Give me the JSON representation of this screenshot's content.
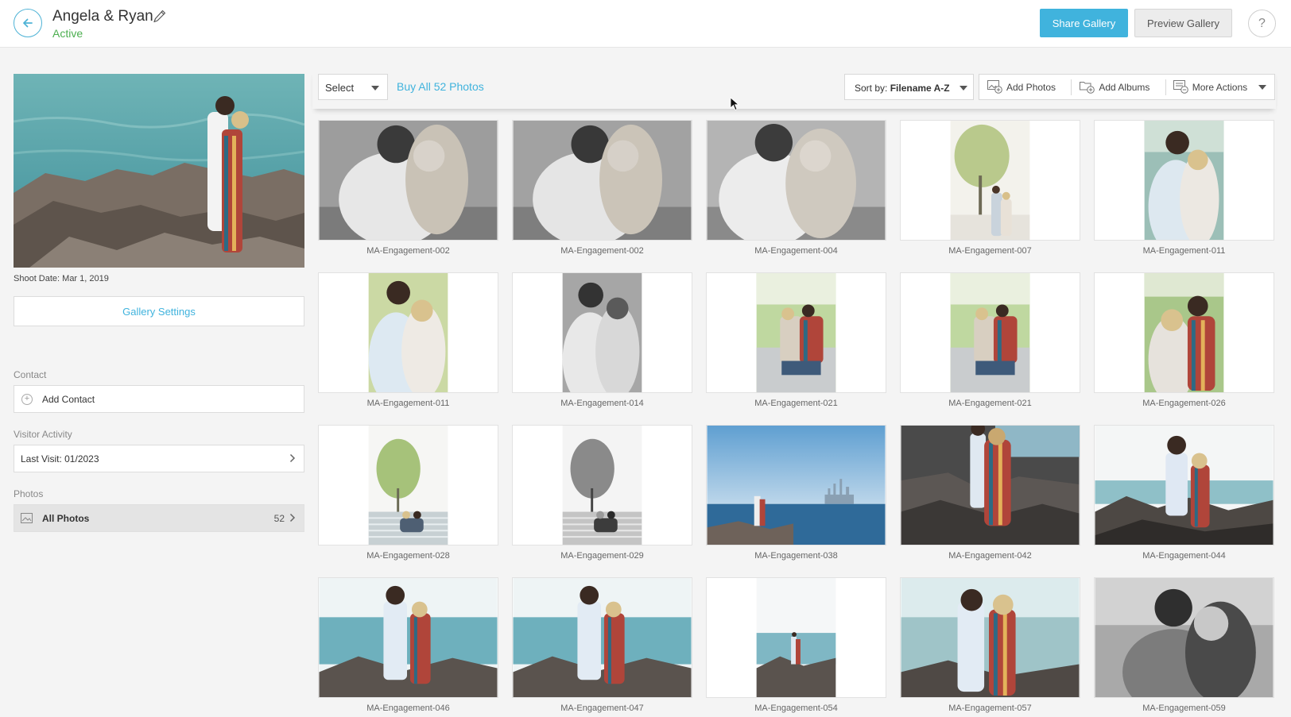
{
  "header": {
    "title": "Angela & Ryan",
    "status": "Active",
    "share_label": "Share Gallery",
    "preview_label": "Preview Gallery",
    "help_label": "?"
  },
  "sidebar": {
    "shoot_date": "Shoot Date: Mar 1, 2019",
    "settings_label": "Gallery Settings",
    "contact_label": "Contact",
    "add_contact_label": "Add Contact",
    "visitor_label": "Visitor Activity",
    "last_visit": "Last Visit: 01/2023",
    "photos_label": "Photos",
    "all_photos_label": "All Photos",
    "all_photos_count": "52"
  },
  "toolbar": {
    "select_label": "Select",
    "buy_all_label": "Buy All 52 Photos",
    "sort_prefix": "Sort by:",
    "sort_value": "Filename A-Z",
    "add_photos_label": "Add Photos",
    "add_albums_label": "Add Albums",
    "more_actions_label": "More Actions"
  },
  "photos": [
    {
      "filename": "MA-Engagement-002"
    },
    {
      "filename": "MA-Engagement-002"
    },
    {
      "filename": "MA-Engagement-004"
    },
    {
      "filename": "MA-Engagement-007"
    },
    {
      "filename": "MA-Engagement-011"
    },
    {
      "filename": "MA-Engagement-011"
    },
    {
      "filename": "MA-Engagement-014"
    },
    {
      "filename": "MA-Engagement-021"
    },
    {
      "filename": "MA-Engagement-021"
    },
    {
      "filename": "MA-Engagement-026"
    },
    {
      "filename": "MA-Engagement-028"
    },
    {
      "filename": "MA-Engagement-029"
    },
    {
      "filename": "MA-Engagement-038"
    },
    {
      "filename": "MA-Engagement-042"
    },
    {
      "filename": "MA-Engagement-044"
    },
    {
      "filename": "MA-Engagement-046"
    },
    {
      "filename": "MA-Engagement-047"
    },
    {
      "filename": "MA-Engagement-054"
    },
    {
      "filename": "MA-Engagement-057"
    },
    {
      "filename": "MA-Engagement-059"
    }
  ],
  "colors": {
    "accent": "#40b3dd",
    "active_status": "#4caf50"
  }
}
